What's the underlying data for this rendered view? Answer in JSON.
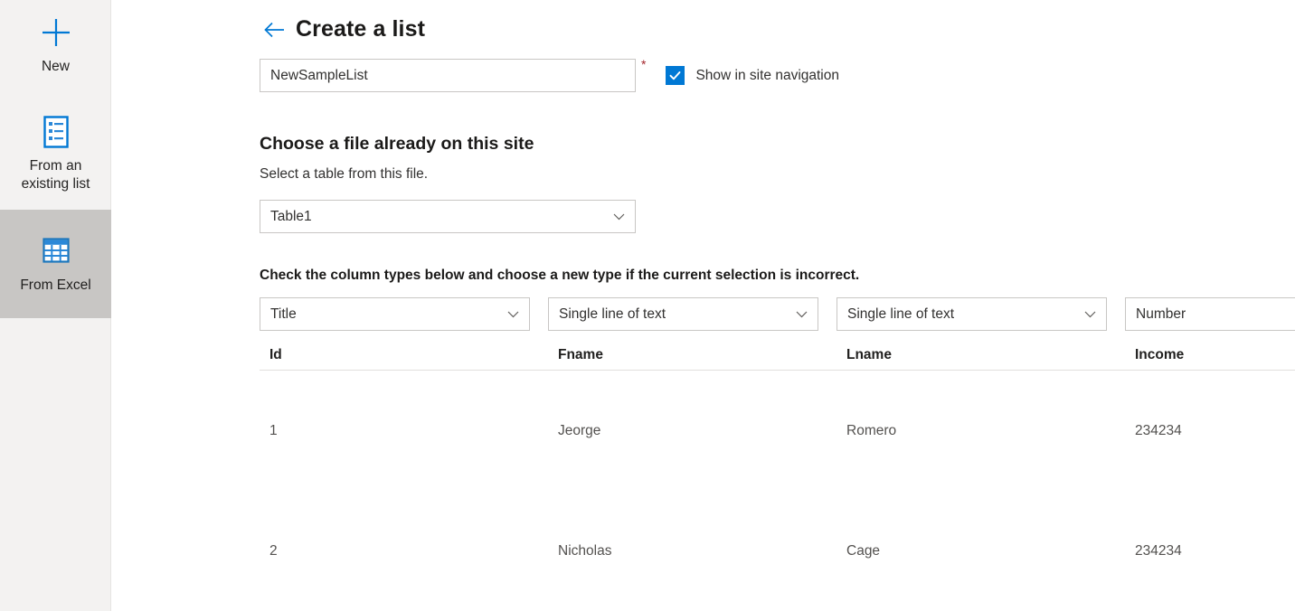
{
  "sidebar": {
    "items": [
      {
        "id": "new",
        "label": "New",
        "icon": "plus-icon",
        "selected": false
      },
      {
        "id": "existing",
        "label": "From an existing list",
        "icon": "list-icon",
        "selected": false
      },
      {
        "id": "excel",
        "label": "From Excel",
        "icon": "excel-grid-icon",
        "selected": true
      }
    ]
  },
  "header": {
    "back_icon": "back-arrow-icon",
    "title": "Create a list"
  },
  "name_field": {
    "value": "NewSampleList",
    "placeholder": "Name",
    "required_marker": "*"
  },
  "site_nav_checkbox": {
    "label": "Show in site navigation",
    "checked": true,
    "icon": "checkmark-icon"
  },
  "file_section": {
    "title": "Choose a file already on this site",
    "subtitle": "Select a table from this file.",
    "table_select": {
      "value": "Table1",
      "chevron_icon": "chevron-down-icon"
    }
  },
  "columns_section": {
    "instruction": "Check the column types below and choose a new type if the current selection is incorrect.",
    "chevron_icon": "chevron-down-icon",
    "columns": [
      {
        "type": "Title",
        "header": "Id"
      },
      {
        "type": "Single line of text",
        "header": "Fname"
      },
      {
        "type": "Single line of text",
        "header": "Lname"
      },
      {
        "type": "Number",
        "header": "Income"
      }
    ],
    "rows": [
      {
        "Id": "1",
        "Fname": "Jeorge",
        "Lname": "Romero",
        "Income": "234234"
      },
      {
        "Id": "2",
        "Fname": "Nicholas",
        "Lname": "Cage",
        "Income": "234234"
      }
    ]
  },
  "colors": {
    "accent": "#0078d4",
    "sidebar_bg": "#f3f2f1",
    "sidebar_selected": "#c8c6c4",
    "required_red": "#a4262c",
    "border": "#c8c6c4",
    "divider": "#e1dfdd"
  }
}
